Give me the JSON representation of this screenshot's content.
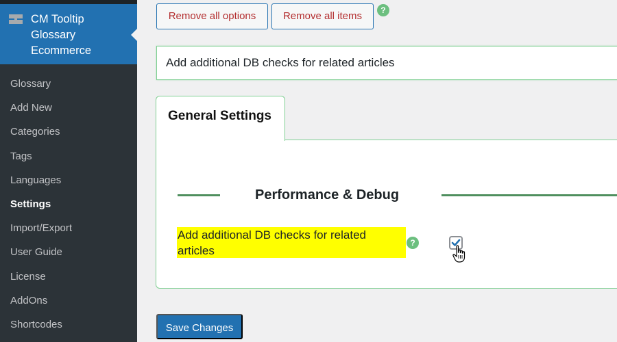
{
  "sidebar": {
    "plugin_title": "CM Tooltip Glossary Ecommerce",
    "items": [
      {
        "label": "Glossary",
        "active": false
      },
      {
        "label": "Add New",
        "active": false
      },
      {
        "label": "Categories",
        "active": false
      },
      {
        "label": "Tags",
        "active": false
      },
      {
        "label": "Languages",
        "active": false
      },
      {
        "label": "Settings",
        "active": true
      },
      {
        "label": "Import/Export",
        "active": false
      },
      {
        "label": "User Guide",
        "active": false
      },
      {
        "label": "License",
        "active": false
      },
      {
        "label": "AddOns",
        "active": false
      },
      {
        "label": "Shortcodes",
        "active": false
      }
    ]
  },
  "toolbar": {
    "remove_options_label": "Remove all options",
    "remove_items_label": "Remove all items",
    "help_icon": "?"
  },
  "search": {
    "value": "Add additional DB checks for related articles"
  },
  "tabs": [
    {
      "label": "General Settings",
      "active": true
    }
  ],
  "section": {
    "title": "Performance & Debug",
    "option": {
      "label": "Add additional DB checks for related articles",
      "help_icon": "?",
      "checked": true
    }
  },
  "footer": {
    "save_label": "Save Changes"
  },
  "colors": {
    "accent": "#2271b1",
    "danger_text": "#b32d2e",
    "highlight": "#ffff00",
    "panel_border": "#7fcf92",
    "rule": "#4f8f5e",
    "help_badge": "#6cbf7f"
  }
}
